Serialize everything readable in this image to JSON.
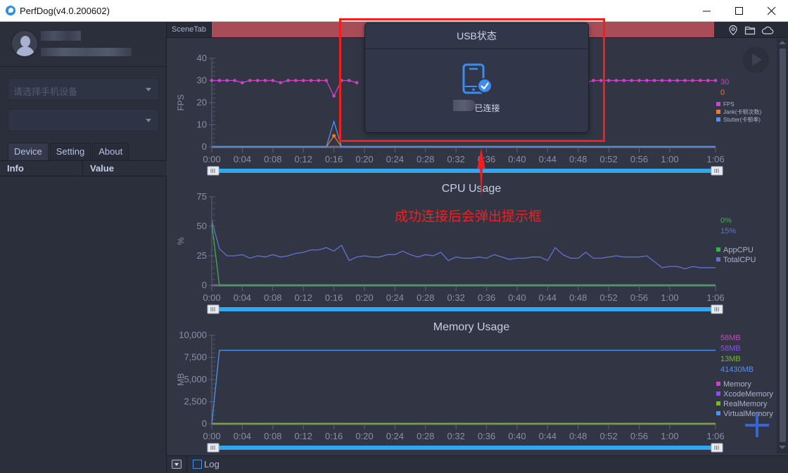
{
  "window": {
    "title": "PerfDog(v4.0.200602)",
    "controls": [
      "minimize",
      "maximize",
      "close"
    ]
  },
  "sidebar": {
    "device_select": {
      "placeholder": "请选择手机设备"
    },
    "app_select": {
      "placeholder": ""
    },
    "tabs": [
      {
        "label": "Device",
        "active": true
      },
      {
        "label": "Setting",
        "active": false
      },
      {
        "label": "About",
        "active": false
      }
    ],
    "table_headers": [
      "Info",
      "Value"
    ]
  },
  "main": {
    "scene_tab_label": "SceneTab",
    "toolbar_icons": [
      "location-icon",
      "folder-icon",
      "cloud-icon"
    ],
    "log_label": "Log",
    "log_checked": false
  },
  "modal": {
    "title": "USB状态",
    "status_text": "已连接",
    "icon": "phone-connected-icon"
  },
  "annotation": {
    "text": "成功连接后会弹出提示框",
    "color": "#f02020"
  },
  "chart_data": [
    {
      "type": "line",
      "title": "",
      "ylabel": "FPS",
      "ylim": [
        0,
        40
      ],
      "yticks": [
        0,
        10,
        20,
        30,
        40
      ],
      "xticks": [
        "0:00",
        "0:04",
        "0:08",
        "0:12",
        "0:16",
        "0:20",
        "0:24",
        "0:28",
        "0:32",
        "0:36",
        "0:40",
        "0:44",
        "0:48",
        "0:52",
        "0:56",
        "1:00",
        "1:06"
      ],
      "x_range_seconds": [
        0,
        66
      ],
      "current_values": [
        {
          "text": "30",
          "color": "#c844c8"
        },
        {
          "text": "0",
          "color": "#f07a28"
        }
      ],
      "legend": [
        {
          "name": "FPS",
          "color": "#c844c8"
        },
        {
          "name": "Jank(卡顿次数)",
          "color": "#f07a28"
        },
        {
          "name": "Stutter(卡顿率)",
          "color": "#4a94f0"
        }
      ],
      "series": [
        {
          "name": "FPS",
          "color": "#c844c8",
          "markers": true,
          "x": [
            0,
            1,
            2,
            3,
            4,
            5,
            6,
            7,
            8,
            9,
            10,
            11,
            12,
            13,
            14,
            15,
            16,
            17,
            18,
            19,
            48,
            49,
            50,
            51,
            52,
            53,
            54,
            55,
            56,
            57,
            58,
            59,
            60,
            61,
            62,
            63,
            64,
            65,
            66
          ],
          "y": [
            30,
            30,
            30,
            30,
            29,
            30,
            30,
            30,
            30,
            29,
            30,
            30,
            30,
            30,
            30,
            30,
            23,
            30,
            30,
            29,
            30,
            29,
            30,
            30,
            30,
            30,
            30,
            30,
            30,
            30,
            30,
            30,
            30,
            30,
            30,
            30,
            30,
            30,
            30
          ]
        },
        {
          "name": "Jank(卡顿次数)",
          "color": "#f07a28",
          "markers": false,
          "x": [
            0,
            15,
            16,
            17,
            66
          ],
          "y": [
            0,
            0,
            5,
            0,
            0
          ]
        },
        {
          "name": "Stutter(卡顿率)",
          "color": "#4a94f0",
          "markers": false,
          "x": [
            0,
            15,
            16,
            17,
            66
          ],
          "y": [
            0,
            0,
            11.5,
            0,
            0
          ]
        }
      ]
    },
    {
      "type": "line",
      "title": "CPU Usage",
      "ylabel": "%",
      "ylim": [
        0,
        75
      ],
      "yticks": [
        0,
        25,
        50,
        75
      ],
      "xticks": [
        "0:00",
        "0:04",
        "0:08",
        "0:12",
        "0:16",
        "0:20",
        "0:24",
        "0:28",
        "0:32",
        "0:36",
        "0:40",
        "0:44",
        "0:48",
        "0:52",
        "0:56",
        "1:00",
        "1:06"
      ],
      "x_range_seconds": [
        0,
        66
      ],
      "current_values": [
        {
          "text": "0%",
          "color": "#3cb050"
        },
        {
          "text": "15%",
          "color": "#6470d0"
        }
      ],
      "legend": [
        {
          "name": "AppCPU",
          "color": "#3cb050"
        },
        {
          "name": "TotalCPU",
          "color": "#6470d0"
        }
      ],
      "series": [
        {
          "name": "AppCPU",
          "color": "#3cb050",
          "x": [
            0,
            1,
            66
          ],
          "y": [
            52,
            0,
            0
          ]
        },
        {
          "name": "TotalCPU",
          "color": "#6470d0",
          "x": [
            0,
            1,
            2,
            3,
            4,
            5,
            6,
            7,
            8,
            9,
            10,
            11,
            12,
            13,
            14,
            15,
            16,
            17,
            18,
            19,
            20,
            21,
            22,
            23,
            24,
            25,
            26,
            27,
            28,
            29,
            30,
            31,
            32,
            33,
            34,
            35,
            36,
            37,
            38,
            39,
            40,
            41,
            42,
            43,
            44,
            45,
            46,
            47,
            48,
            49,
            50,
            51,
            52,
            53,
            54,
            55,
            56,
            57,
            58,
            59,
            60,
            61,
            62,
            63,
            64,
            65,
            66
          ],
          "y": [
            55,
            31,
            25,
            25,
            26,
            23,
            25,
            24,
            26,
            24,
            25,
            27,
            28,
            30,
            30,
            32,
            29,
            34,
            21,
            24,
            25,
            24,
            24,
            26,
            26,
            29,
            26,
            24,
            26,
            25,
            28,
            21,
            24,
            23,
            23,
            24,
            23,
            26,
            24,
            22,
            23,
            23,
            24,
            24,
            21,
            32,
            26,
            23,
            23,
            28,
            23,
            23,
            24,
            25,
            24,
            24,
            24,
            25,
            20,
            15,
            16,
            16,
            14,
            16,
            15,
            15,
            15
          ]
        }
      ]
    },
    {
      "type": "line",
      "title": "Memory Usage",
      "ylabel": "MB",
      "ylim": [
        0,
        10000
      ],
      "yticks": [
        0,
        2500,
        5000,
        7500,
        10000
      ],
      "ytick_labels": [
        "0",
        "2,500",
        "5,000",
        "7,500",
        "10,000"
      ],
      "xticks": [
        "0:00",
        "0:04",
        "0:08",
        "0:12",
        "0:16",
        "0:20",
        "0:24",
        "0:28",
        "0:32",
        "0:36",
        "0:40",
        "0:44",
        "0:48",
        "0:52",
        "0:56",
        "1:00",
        "1:06"
      ],
      "x_range_seconds": [
        0,
        66
      ],
      "current_values": [
        {
          "text": "58MB",
          "color": "#c844c8"
        },
        {
          "text": "58MB",
          "color": "#8a4ef0"
        },
        {
          "text": "13MB",
          "color": "#7ab820"
        },
        {
          "text": "41430MB",
          "color": "#4a94f0"
        }
      ],
      "legend": [
        {
          "name": "Memory",
          "color": "#c844c8"
        },
        {
          "name": "XcodeMemory",
          "color": "#8a4ef0"
        },
        {
          "name": "RealMemory",
          "color": "#7ab820"
        },
        {
          "name": "VirtualMemory",
          "color": "#4a94f0"
        }
      ],
      "series": [
        {
          "name": "Memory",
          "color": "#c844c8",
          "x": [
            0,
            66
          ],
          "y": [
            58,
            58
          ]
        },
        {
          "name": "XcodeMemory",
          "color": "#8a4ef0",
          "x": [
            0,
            66
          ],
          "y": [
            58,
            58
          ]
        },
        {
          "name": "RealMemory",
          "color": "#7ab820",
          "x": [
            0,
            66
          ],
          "y": [
            13,
            13
          ]
        },
        {
          "name": "VirtualMemory",
          "color": "#4a94f0",
          "x": [
            0,
            1,
            66
          ],
          "y": [
            0,
            8300,
            8300
          ]
        }
      ]
    }
  ]
}
